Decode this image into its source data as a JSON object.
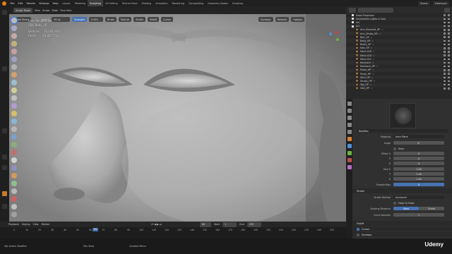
{
  "menus": [
    "File",
    "Edit",
    "Render",
    "Window",
    "Help"
  ],
  "workspaces": [
    "Layout",
    "Modeling",
    "Sculpting",
    "UV Editing",
    "Texture Paint",
    "Shading",
    "Animation",
    "Rendering",
    "Compositing",
    "Geometry Nodes",
    "Scripting"
  ],
  "active_workspace": "Sculpting",
  "scene_label": "Scene",
  "viewlayer_label": "ViewLayer",
  "viewport_header": {
    "mode": "Sculpt Mode",
    "menu_items": [
      "View",
      "Sculpt",
      "Mask",
      "Face Sets"
    ],
    "brush": "Draw Sharp",
    "radius_label": "Radius",
    "radius_value": "34 px",
    "strength_label": "Strength",
    "strength_value": "0.500",
    "brush_menus": [
      "Brush",
      "Texture",
      "Stroke",
      "Falloff",
      "Cursor"
    ],
    "dyntopo": "Dyntopo",
    "remesh": "Remesh",
    "options": "Options"
  },
  "overlay": {
    "view_name": "User Perspective",
    "object_name": "(64) Body_LP",
    "vertices_label": "Vertices",
    "vertices_value": "10,101,932",
    "faces_label": "Faces",
    "faces_value": "20,827,712"
  },
  "playback": {
    "menus": [
      "Playback",
      "Keying",
      "View",
      "Marker"
    ],
    "current_frame": "64",
    "start_label": "Start",
    "start_value": "1",
    "end_label": "End",
    "end_value": "250",
    "ticks": [
      "0",
      "10",
      "20",
      "30",
      "40",
      "50",
      "60",
      "70",
      "80",
      "90",
      "100",
      "110",
      "120",
      "130",
      "140",
      "150",
      "160",
      "170",
      "180",
      "190",
      "200",
      "210",
      "220",
      "230",
      "240",
      "250"
    ]
  },
  "status": {
    "left": "Set Active Modifier",
    "middle": "Pan View",
    "right": "Context Menu"
  },
  "watermark": "Udemy",
  "outliner": {
    "items": [
      {
        "name": "Head Projection",
        "kind": "col"
      },
      {
        "name": "Geometries Lights & Cam",
        "kind": "col"
      },
      {
        "name": "Art",
        "kind": "col"
      },
      {
        "name": "Art",
        "kind": "col"
      },
      {
        "name": "Arm_Bracelet_HP",
        "kind": "mesh"
      },
      {
        "name": "Arm_Shoes_HP",
        "kind": "mesh"
      },
      {
        "name": "Belt_HP",
        "kind": "mesh"
      },
      {
        "name": "Body_HP",
        "kind": "mesh"
      },
      {
        "name": "Boots_HP",
        "kind": "mesh"
      },
      {
        "name": "Hair_HP",
        "kind": "mesh"
      },
      {
        "name": "Mesh.018",
        "kind": "mesh"
      },
      {
        "name": "Mesh.019",
        "kind": "mesh"
      },
      {
        "name": "Mesh.021",
        "kind": "mesh"
      },
      {
        "name": "Necklace",
        "kind": "mesh"
      },
      {
        "name": "Necklace_HP",
        "kind": "mesh"
      },
      {
        "name": "Pants_HP",
        "kind": "mesh"
      },
      {
        "name": "Pants_HP",
        "kind": "mesh"
      },
      {
        "name": "Shirt_HP",
        "kind": "mesh"
      },
      {
        "name": "Straps_HP",
        "kind": "mesh"
      },
      {
        "name": "Top_HP",
        "kind": "mesh"
      },
      {
        "name": "Vest_HP",
        "kind": "mesh"
      }
    ]
  },
  "properties": {
    "texture_name": "Neptflas",
    "mapping_label": "Mapping",
    "mapping_value": "Area Plane",
    "angle_label": "Angle",
    "angle_value": "0°",
    "rake_label": "Rake",
    "offset_label": "Offset X",
    "offset_values": [
      "0",
      "0",
      "0"
    ],
    "size_label": "Size X",
    "size_values": [
      "1.00",
      "1.00",
      "1.00"
    ],
    "sample_bias_label": "Sample Bias",
    "sample_bias_value": "0",
    "stroke_header": "Stroke",
    "stroke_method_label": "Stroke Method",
    "stroke_method_value": "Anchored",
    "edge_to_edge": "Edge to Edge",
    "spacing_label": "Spacing Distance",
    "spacing_options": [
      "View",
      "Scene"
    ],
    "input_samples_label": "Input Samples",
    "input_samples_value": "1",
    "falloff_header": "Falloff",
    "cursor_header": "Cursor",
    "dyntopo_header": "Dyntopo"
  },
  "colors": {
    "accent": "#4772b3",
    "blender_orange": "#e87d0d",
    "panel": "#303030",
    "header": "#202020"
  }
}
